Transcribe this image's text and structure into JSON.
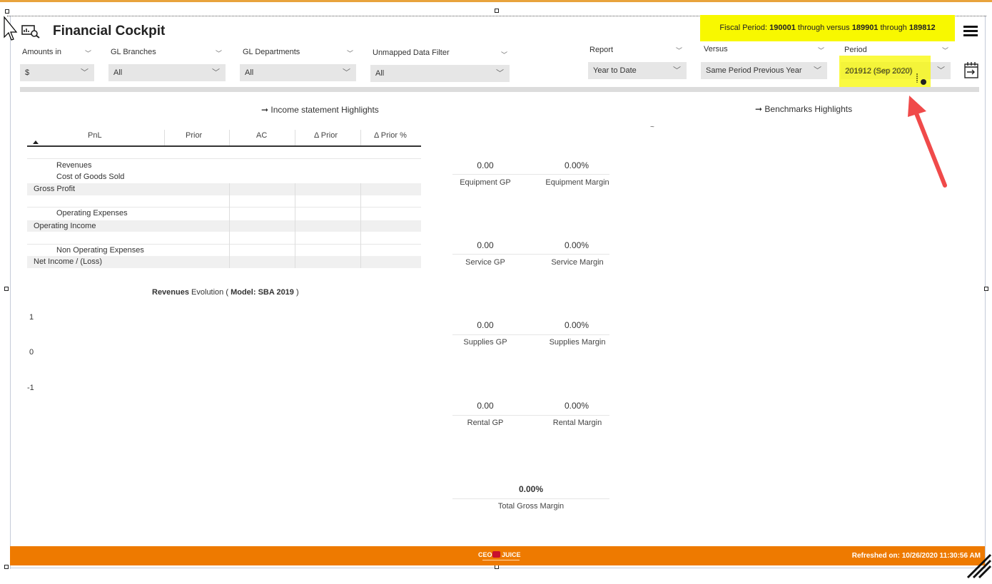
{
  "app": {
    "title": "Financial Cockpit",
    "fiscal_banner": {
      "prefix": "Fiscal Period: ",
      "from": "190001",
      "through1": " through  versus ",
      "versus_from": "189901",
      "through2": " through ",
      "versus_to": "189812"
    }
  },
  "filters": {
    "amounts_in": {
      "label": "Amounts in",
      "value": "$"
    },
    "gl_branches": {
      "label": "GL Branches",
      "value": "All"
    },
    "gl_departments": {
      "label": "GL Departments",
      "value": "All"
    },
    "unmapped": {
      "label": "Unmapped Data Filter",
      "value": "All"
    },
    "report": {
      "label": "Report",
      "value": "Year to Date"
    },
    "versus": {
      "label": "Versus",
      "value": "Same Period Previous Year"
    },
    "period": {
      "label": "Period",
      "value": "201912 (Sep 2020)"
    }
  },
  "income": {
    "title": "➞ Income statement Highlights",
    "columns": [
      "PnL",
      "Prior",
      "AC",
      "Δ Prior",
      "Δ Prior %"
    ],
    "rows": [
      "Revenues",
      "Cost of Goods Sold",
      "Gross Profit",
      "Operating Expenses",
      "Operating Income",
      "Non Operating Expenses",
      "Net Income / (Loss)"
    ]
  },
  "benchmarks": {
    "title": "➞ Benchmarks Highlights",
    "tilde": "~"
  },
  "kpis": [
    {
      "value": "0.00",
      "label": "Equipment GP",
      "margin_value": "0.00%",
      "margin_label": "Equipment Margin"
    },
    {
      "value": "0.00",
      "label": "Service GP",
      "margin_value": "0.00%",
      "margin_label": "Service Margin"
    },
    {
      "value": "0.00",
      "label": "Supplies GP",
      "margin_value": "0.00%",
      "margin_label": "Supplies Margin"
    },
    {
      "value": "0.00",
      "label": "Rental GP",
      "margin_value": "0.00%",
      "margin_label": "Rental Margin"
    }
  ],
  "total": {
    "value": "0.00%",
    "label": "Total Gross Margin"
  },
  "revenues_chart": {
    "title_bold": "Revenues",
    "title_rest": " Evolution ( ",
    "model_bold": "Model: SBA 2019",
    "title_end": " )",
    "ticks": [
      "1",
      "0",
      "-1"
    ]
  },
  "footer": {
    "logo_text_left": "CEO",
    "logo_text_right": "JUICE",
    "refreshed": "Refreshed on: 10/26/2020 11:30:56 AM"
  },
  "colors": {
    "footer": "#ee7a00",
    "highlight": "#f8f800",
    "arrow": "#f04a4a"
  },
  "icons": [
    "report-view-icon",
    "hamburger-menu-icon",
    "export-icon",
    "chevron-down-icon",
    "sort-asc-icon",
    "red-arrow-annotation"
  ]
}
